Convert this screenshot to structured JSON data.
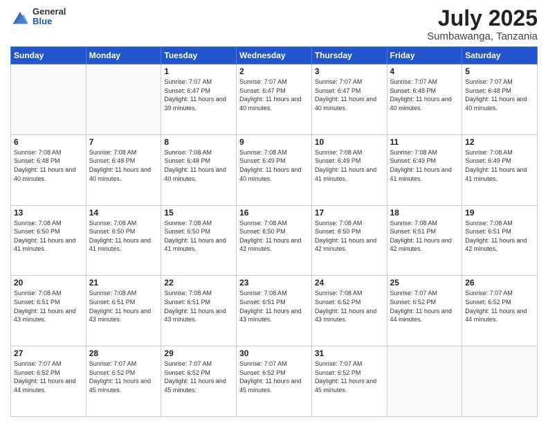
{
  "header": {
    "logo_general": "General",
    "logo_blue": "Blue",
    "title": "July 2025",
    "location": "Sumbawanga, Tanzania"
  },
  "weekdays": [
    "Sunday",
    "Monday",
    "Tuesday",
    "Wednesday",
    "Thursday",
    "Friday",
    "Saturday"
  ],
  "weeks": [
    [
      {
        "day": "",
        "sunrise": "",
        "sunset": "",
        "daylight": ""
      },
      {
        "day": "",
        "sunrise": "",
        "sunset": "",
        "daylight": ""
      },
      {
        "day": "1",
        "sunrise": "Sunrise: 7:07 AM",
        "sunset": "Sunset: 6:47 PM",
        "daylight": "Daylight: 11 hours and 39 minutes."
      },
      {
        "day": "2",
        "sunrise": "Sunrise: 7:07 AM",
        "sunset": "Sunset: 6:47 PM",
        "daylight": "Daylight: 11 hours and 40 minutes."
      },
      {
        "day": "3",
        "sunrise": "Sunrise: 7:07 AM",
        "sunset": "Sunset: 6:47 PM",
        "daylight": "Daylight: 11 hours and 40 minutes."
      },
      {
        "day": "4",
        "sunrise": "Sunrise: 7:07 AM",
        "sunset": "Sunset: 6:48 PM",
        "daylight": "Daylight: 11 hours and 40 minutes."
      },
      {
        "day": "5",
        "sunrise": "Sunrise: 7:07 AM",
        "sunset": "Sunset: 6:48 PM",
        "daylight": "Daylight: 11 hours and 40 minutes."
      }
    ],
    [
      {
        "day": "6",
        "sunrise": "Sunrise: 7:08 AM",
        "sunset": "Sunset: 6:48 PM",
        "daylight": "Daylight: 11 hours and 40 minutes."
      },
      {
        "day": "7",
        "sunrise": "Sunrise: 7:08 AM",
        "sunset": "Sunset: 6:48 PM",
        "daylight": "Daylight: 11 hours and 40 minutes."
      },
      {
        "day": "8",
        "sunrise": "Sunrise: 7:08 AM",
        "sunset": "Sunset: 6:48 PM",
        "daylight": "Daylight: 11 hours and 40 minutes."
      },
      {
        "day": "9",
        "sunrise": "Sunrise: 7:08 AM",
        "sunset": "Sunset: 6:49 PM",
        "daylight": "Daylight: 11 hours and 40 minutes."
      },
      {
        "day": "10",
        "sunrise": "Sunrise: 7:08 AM",
        "sunset": "Sunset: 6:49 PM",
        "daylight": "Daylight: 11 hours and 41 minutes."
      },
      {
        "day": "11",
        "sunrise": "Sunrise: 7:08 AM",
        "sunset": "Sunset: 6:49 PM",
        "daylight": "Daylight: 11 hours and 41 minutes."
      },
      {
        "day": "12",
        "sunrise": "Sunrise: 7:08 AM",
        "sunset": "Sunset: 6:49 PM",
        "daylight": "Daylight: 11 hours and 41 minutes."
      }
    ],
    [
      {
        "day": "13",
        "sunrise": "Sunrise: 7:08 AM",
        "sunset": "Sunset: 6:50 PM",
        "daylight": "Daylight: 11 hours and 41 minutes."
      },
      {
        "day": "14",
        "sunrise": "Sunrise: 7:08 AM",
        "sunset": "Sunset: 6:50 PM",
        "daylight": "Daylight: 11 hours and 41 minutes."
      },
      {
        "day": "15",
        "sunrise": "Sunrise: 7:08 AM",
        "sunset": "Sunset: 6:50 PM",
        "daylight": "Daylight: 11 hours and 41 minutes."
      },
      {
        "day": "16",
        "sunrise": "Sunrise: 7:08 AM",
        "sunset": "Sunset: 6:50 PM",
        "daylight": "Daylight: 11 hours and 42 minutes."
      },
      {
        "day": "17",
        "sunrise": "Sunrise: 7:08 AM",
        "sunset": "Sunset: 6:50 PM",
        "daylight": "Daylight: 11 hours and 42 minutes."
      },
      {
        "day": "18",
        "sunrise": "Sunrise: 7:08 AM",
        "sunset": "Sunset: 6:51 PM",
        "daylight": "Daylight: 11 hours and 42 minutes."
      },
      {
        "day": "19",
        "sunrise": "Sunrise: 7:08 AM",
        "sunset": "Sunset: 6:51 PM",
        "daylight": "Daylight: 11 hours and 42 minutes."
      }
    ],
    [
      {
        "day": "20",
        "sunrise": "Sunrise: 7:08 AM",
        "sunset": "Sunset: 6:51 PM",
        "daylight": "Daylight: 11 hours and 43 minutes."
      },
      {
        "day": "21",
        "sunrise": "Sunrise: 7:08 AM",
        "sunset": "Sunset: 6:51 PM",
        "daylight": "Daylight: 11 hours and 43 minutes."
      },
      {
        "day": "22",
        "sunrise": "Sunrise: 7:08 AM",
        "sunset": "Sunset: 6:51 PM",
        "daylight": "Daylight: 11 hours and 43 minutes."
      },
      {
        "day": "23",
        "sunrise": "Sunrise: 7:08 AM",
        "sunset": "Sunset: 6:51 PM",
        "daylight": "Daylight: 11 hours and 43 minutes."
      },
      {
        "day": "24",
        "sunrise": "Sunrise: 7:08 AM",
        "sunset": "Sunset: 6:52 PM",
        "daylight": "Daylight: 11 hours and 43 minutes."
      },
      {
        "day": "25",
        "sunrise": "Sunrise: 7:07 AM",
        "sunset": "Sunset: 6:52 PM",
        "daylight": "Daylight: 11 hours and 44 minutes."
      },
      {
        "day": "26",
        "sunrise": "Sunrise: 7:07 AM",
        "sunset": "Sunset: 6:52 PM",
        "daylight": "Daylight: 11 hours and 44 minutes."
      }
    ],
    [
      {
        "day": "27",
        "sunrise": "Sunrise: 7:07 AM",
        "sunset": "Sunset: 6:52 PM",
        "daylight": "Daylight: 11 hours and 44 minutes."
      },
      {
        "day": "28",
        "sunrise": "Sunrise: 7:07 AM",
        "sunset": "Sunset: 6:52 PM",
        "daylight": "Daylight: 11 hours and 45 minutes."
      },
      {
        "day": "29",
        "sunrise": "Sunrise: 7:07 AM",
        "sunset": "Sunset: 6:52 PM",
        "daylight": "Daylight: 11 hours and 45 minutes."
      },
      {
        "day": "30",
        "sunrise": "Sunrise: 7:07 AM",
        "sunset": "Sunset: 6:52 PM",
        "daylight": "Daylight: 11 hours and 45 minutes."
      },
      {
        "day": "31",
        "sunrise": "Sunrise: 7:07 AM",
        "sunset": "Sunset: 6:52 PM",
        "daylight": "Daylight: 11 hours and 45 minutes."
      },
      {
        "day": "",
        "sunrise": "",
        "sunset": "",
        "daylight": ""
      },
      {
        "day": "",
        "sunrise": "",
        "sunset": "",
        "daylight": ""
      }
    ]
  ]
}
